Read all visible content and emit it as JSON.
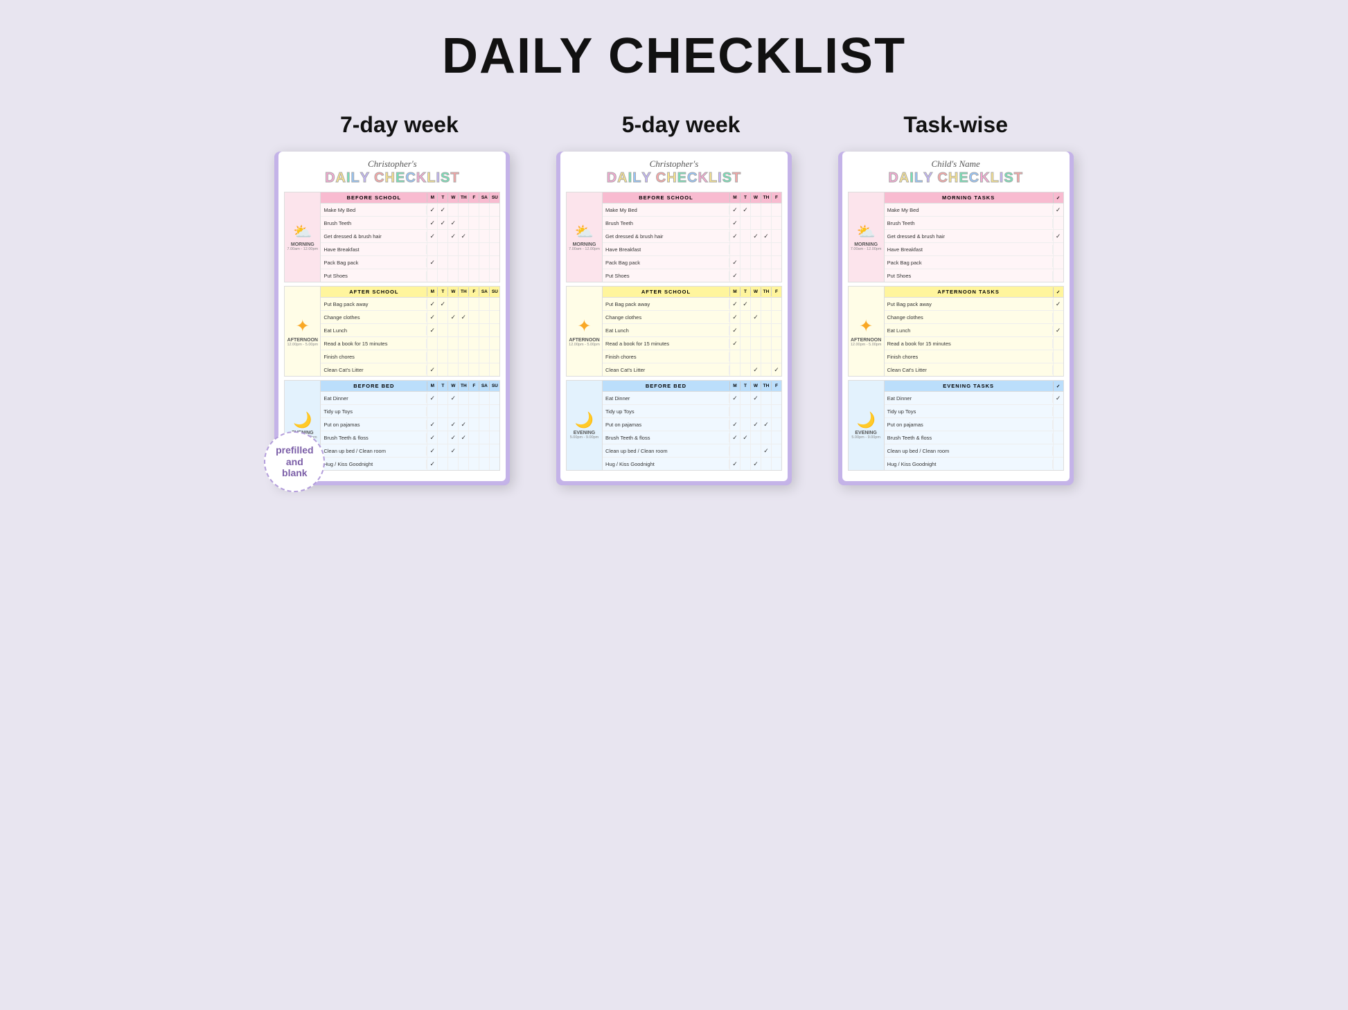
{
  "page": {
    "title": "DAILY CHECKLIST",
    "bg_color": "#e8e5f0"
  },
  "variants": [
    {
      "label": "7-day week"
    },
    {
      "label": "5-day week"
    },
    {
      "label": "Task-wise"
    }
  ],
  "cards": [
    {
      "id": "seven-day",
      "name": "Christopher's",
      "title": "DAILY CHECKLIST",
      "days": [
        "M",
        "T",
        "W",
        "TH",
        "F",
        "SA",
        "SU"
      ],
      "sections": [
        {
          "id": "morning",
          "icon": "☀️🌤",
          "label": "MORNING",
          "time": "7.00am - 12.00pm",
          "header": "BEFORE SCHOOL",
          "color": "morning",
          "tasks": [
            {
              "name": "Make My Bed",
              "checks": [
                "✓",
                "✓",
                "",
                "",
                "",
                "",
                ""
              ]
            },
            {
              "name": "Brush Teeth",
              "checks": [
                "✓",
                "✓",
                "✓",
                "",
                "",
                "",
                ""
              ]
            },
            {
              "name": "Get dressed & brush hair",
              "checks": [
                "✓",
                "",
                "✓",
                "✓",
                "",
                "",
                ""
              ]
            },
            {
              "name": "Have Breakfast",
              "checks": [
                "",
                "",
                "",
                "",
                "",
                "",
                ""
              ]
            },
            {
              "name": "Pack Bag pack",
              "checks": [
                "✓",
                "",
                "",
                "",
                "",
                "",
                ""
              ]
            },
            {
              "name": "Put Shoes",
              "checks": [
                "",
                "",
                "",
                "",
                "",
                "",
                ""
              ]
            }
          ]
        },
        {
          "id": "afternoon",
          "icon": "🌟",
          "label": "AFTERNOON",
          "time": "12.00pm - 5.00pm",
          "header": "AFTER SCHOOL",
          "color": "afternoon",
          "tasks": [
            {
              "name": "Put Bag pack away",
              "checks": [
                "✓",
                "✓",
                "",
                "",
                "",
                "",
                ""
              ]
            },
            {
              "name": "Change clothes",
              "checks": [
                "✓",
                "",
                "✓",
                "✓",
                "",
                "",
                ""
              ]
            },
            {
              "name": "Eat Lunch",
              "checks": [
                "✓",
                "",
                "",
                "",
                "",
                "",
                ""
              ]
            },
            {
              "name": "Read a book for 15 minutes",
              "checks": [
                "",
                "",
                "",
                "",
                "",
                "",
                ""
              ]
            },
            {
              "name": "Finish chores",
              "checks": [
                "",
                "",
                "",
                "",
                "",
                "",
                ""
              ]
            },
            {
              "name": "Clean Cat's Litter",
              "checks": [
                "✓",
                "",
                "",
                "",
                "",
                "",
                ""
              ]
            }
          ]
        },
        {
          "id": "evening",
          "icon": "🌙",
          "label": "EVENING",
          "time": "5.00pm - 9.00pm",
          "header": "BEFORE BED",
          "color": "evening",
          "tasks": [
            {
              "name": "Eat Dinner",
              "checks": [
                "✓",
                "",
                "✓",
                "",
                "",
                "",
                ""
              ]
            },
            {
              "name": "Tidy up Toys",
              "checks": [
                "",
                "",
                "",
                "",
                "",
                "",
                ""
              ]
            },
            {
              "name": "Put on pajamas",
              "checks": [
                "✓",
                "",
                "✓",
                "✓",
                "",
                "",
                ""
              ]
            },
            {
              "name": "Brush Teeth & floss",
              "checks": [
                "✓",
                "",
                "✓",
                "✓",
                "",
                "",
                ""
              ]
            },
            {
              "name": "Clean up bed / Clean room",
              "checks": [
                "✓",
                "",
                "✓",
                "",
                "",
                "",
                ""
              ]
            },
            {
              "name": "Hug / Kiss Goodnight",
              "checks": [
                "✓",
                "",
                "",
                "",
                "",
                "",
                ""
              ]
            }
          ]
        }
      ]
    },
    {
      "id": "five-day",
      "name": "Christopher's",
      "title": "DAILY CHECKLIST",
      "days": [
        "M",
        "T",
        "W",
        "TH",
        "F"
      ],
      "sections": [
        {
          "id": "morning",
          "icon": "☀️🌤",
          "label": "MORNING",
          "time": "7.00am - 12.00pm",
          "header": "BEFORE SCHOOL",
          "color": "morning",
          "tasks": [
            {
              "name": "Make My Bed",
              "checks": [
                "✓",
                "✓",
                "",
                "",
                ""
              ]
            },
            {
              "name": "Brush Teeth",
              "checks": [
                "✓",
                "",
                "",
                "",
                ""
              ]
            },
            {
              "name": "Get dressed & brush hair",
              "checks": [
                "✓",
                "",
                "✓",
                "✓",
                ""
              ]
            },
            {
              "name": "Have Breakfast",
              "checks": [
                "",
                "",
                "",
                "",
                ""
              ]
            },
            {
              "name": "Pack Bag pack",
              "checks": [
                "✓",
                "",
                "",
                "",
                ""
              ]
            },
            {
              "name": "Put Shoes",
              "checks": [
                "✓",
                "",
                "",
                "",
                ""
              ]
            }
          ]
        },
        {
          "id": "afternoon",
          "icon": "🌟",
          "label": "AFTERNOON",
          "time": "12.00pm - 5.00pm",
          "header": "AFTER SCHOOL",
          "color": "afternoon",
          "tasks": [
            {
              "name": "Put Bag pack away",
              "checks": [
                "✓",
                "✓",
                "",
                "",
                ""
              ]
            },
            {
              "name": "Change clothes",
              "checks": [
                "✓",
                "",
                "✓",
                "",
                ""
              ]
            },
            {
              "name": "Eat Lunch",
              "checks": [
                "✓",
                "",
                "",
                "",
                ""
              ]
            },
            {
              "name": "Read a book for 15 minutes",
              "checks": [
                "✓",
                "",
                "",
                "",
                ""
              ]
            },
            {
              "name": "Finish chores",
              "checks": [
                "",
                "",
                "",
                "",
                ""
              ]
            },
            {
              "name": "Clean Cat's Litter",
              "checks": [
                "",
                "",
                "✓",
                "",
                "✓"
              ]
            }
          ]
        },
        {
          "id": "evening",
          "icon": "🌙",
          "label": "EVENING",
          "time": "5.00pm - 9.00pm",
          "header": "BEFORE BED",
          "color": "evening",
          "tasks": [
            {
              "name": "Eat Dinner",
              "checks": [
                "✓",
                "",
                "✓",
                "",
                ""
              ]
            },
            {
              "name": "Tidy up Toys",
              "checks": [
                "",
                "",
                "",
                "",
                ""
              ]
            },
            {
              "name": "Put on pajamas",
              "checks": [
                "✓",
                "",
                "✓",
                "✓",
                ""
              ]
            },
            {
              "name": "Brush Teeth & floss",
              "checks": [
                "✓",
                "✓",
                "",
                "",
                ""
              ]
            },
            {
              "name": "Clean up bed / Clean room",
              "checks": [
                "",
                "",
                "",
                "✓",
                ""
              ]
            },
            {
              "name": "Hug / Kiss Goodnight",
              "checks": [
                "✓",
                "",
                "✓",
                "",
                ""
              ]
            }
          ]
        }
      ]
    },
    {
      "id": "task-wise",
      "name": "Child's Name",
      "title": "DAILY CHECKLIST",
      "days": [
        "✓"
      ],
      "sections": [
        {
          "id": "morning",
          "icon": "☀️🌤",
          "label": "MORNING",
          "time": "7.00am - 12.00pm",
          "header": "MORNING TASKS",
          "color": "morning",
          "tasks": [
            {
              "name": "Make My Bed",
              "checks": [
                "✓"
              ]
            },
            {
              "name": "Brush Teeth",
              "checks": [
                ""
              ]
            },
            {
              "name": "Get dressed & brush hair",
              "checks": [
                "✓"
              ]
            },
            {
              "name": "Have Breakfast",
              "checks": [
                ""
              ]
            },
            {
              "name": "Pack Bag pack",
              "checks": [
                ""
              ]
            },
            {
              "name": "Put Shoes",
              "checks": [
                ""
              ]
            }
          ]
        },
        {
          "id": "afternoon",
          "icon": "🌟",
          "label": "AFTERNOON",
          "time": "12.00pm - 5.00pm",
          "header": "AFTERNOON TASKS",
          "color": "afternoon",
          "tasks": [
            {
              "name": "Put Bag pack away",
              "checks": [
                "✓"
              ]
            },
            {
              "name": "Change clothes",
              "checks": [
                ""
              ]
            },
            {
              "name": "Eat Lunch",
              "checks": [
                "✓"
              ]
            },
            {
              "name": "Read a book for 15 minutes",
              "checks": [
                ""
              ]
            },
            {
              "name": "Finish chores",
              "checks": [
                ""
              ]
            },
            {
              "name": "Clean Cat's Litter",
              "checks": [
                ""
              ]
            }
          ]
        },
        {
          "id": "evening",
          "icon": "🌙",
          "label": "EVENING",
          "time": "5.00pm - 9.00pm",
          "header": "EVENING TASKS",
          "color": "evening",
          "tasks": [
            {
              "name": "Eat Dinner",
              "checks": [
                "✓"
              ]
            },
            {
              "name": "Tidy up Toys",
              "checks": [
                ""
              ]
            },
            {
              "name": "Put on pajamas",
              "checks": [
                ""
              ]
            },
            {
              "name": "Brush Teeth & floss",
              "checks": [
                ""
              ]
            },
            {
              "name": "Clean up bed / Clean room",
              "checks": [
                ""
              ]
            },
            {
              "name": "Hug / Kiss Goodnight",
              "checks": [
                ""
              ]
            }
          ]
        }
      ]
    }
  ],
  "stamp": {
    "line1": "prefilled",
    "line2": "and",
    "line3": "blank"
  }
}
